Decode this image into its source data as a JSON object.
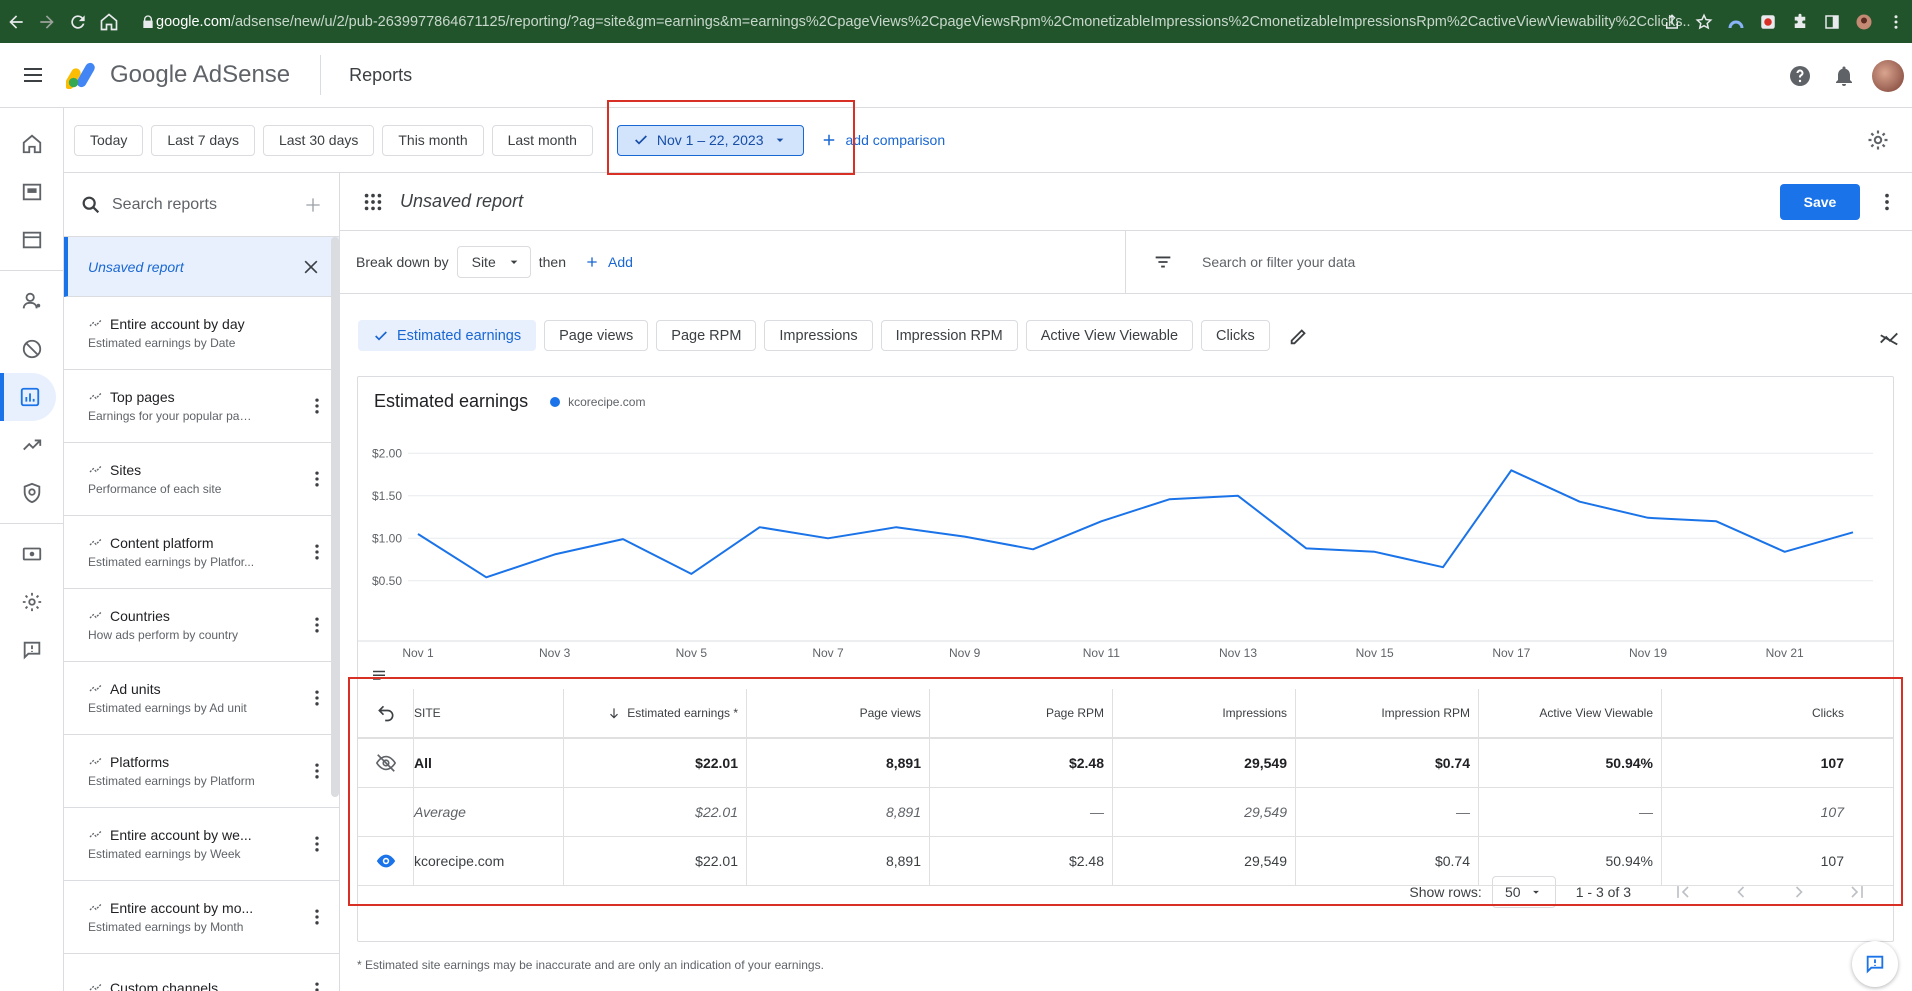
{
  "browser": {
    "url_host": "google.com",
    "url_path": "/adsense/new/u/2/pub-2639977864671125/reporting/?ag=site&gm=earnings&m=earnings%2CpageViews%2CpageViewsRpm%2CmonetizableImpressions%2CmonetizableImpressionsRpm%2CactiveViewViewability%2Cclicks..."
  },
  "header": {
    "product_google": "Google",
    "product_name": "AdSense",
    "title": "Reports"
  },
  "date_ranges": [
    "Today",
    "Last 7 days",
    "Last 30 days",
    "This month",
    "Last month"
  ],
  "selected_range": "Nov 1 – 22, 2023",
  "add_comparison": "add comparison",
  "sidebar": {
    "search_placeholder": "Search reports",
    "active_report": "Unsaved report",
    "reports": [
      {
        "title": "Entire account by day",
        "subtitle": "Estimated earnings by Date"
      },
      {
        "title": "Top pages",
        "subtitle": "Earnings for your popular pages"
      },
      {
        "title": "Sites",
        "subtitle": "Performance of each site"
      },
      {
        "title": "Content platform",
        "subtitle": "Estimated earnings by Platfor..."
      },
      {
        "title": "Countries",
        "subtitle": "How ads perform by country"
      },
      {
        "title": "Ad units",
        "subtitle": "Estimated earnings by Ad unit"
      },
      {
        "title": "Platforms",
        "subtitle": "Estimated earnings by Platform"
      },
      {
        "title": "Entire account by we...",
        "subtitle": "Estimated earnings by Week"
      },
      {
        "title": "Entire account by mo...",
        "subtitle": "Estimated earnings by Month"
      },
      {
        "title": "Custom channels",
        "subtitle": ""
      }
    ]
  },
  "report": {
    "title": "Unsaved report",
    "save_label": "Save",
    "breakdown_label": "Break down by",
    "breakdown_value": "Site",
    "then_label": "then",
    "add_label": "Add",
    "filter_placeholder": "Search or filter your data",
    "metrics": [
      "Estimated earnings",
      "Page views",
      "Page RPM",
      "Impressions",
      "Impression RPM",
      "Active View Viewable",
      "Clicks"
    ]
  },
  "chart_data": {
    "type": "line",
    "title": "Estimated earnings",
    "series": [
      {
        "name": "kcorecipe.com",
        "color": "#1a73e8",
        "values": [
          1.05,
          0.54,
          0.81,
          0.99,
          0.58,
          1.13,
          1.0,
          1.13,
          1.02,
          0.87,
          1.2,
          1.46,
          1.5,
          0.88,
          0.84,
          0.66,
          1.8,
          1.43,
          1.24,
          1.2,
          0.84,
          1.07
        ]
      }
    ],
    "x": [
      "Nov 1",
      "Nov 2",
      "Nov 3",
      "Nov 4",
      "Nov 5",
      "Nov 6",
      "Nov 7",
      "Nov 8",
      "Nov 9",
      "Nov 10",
      "Nov 11",
      "Nov 12",
      "Nov 13",
      "Nov 14",
      "Nov 15",
      "Nov 16",
      "Nov 17",
      "Nov 18",
      "Nov 19",
      "Nov 20",
      "Nov 21",
      "Nov 22"
    ],
    "x_tick_labels": [
      "Nov 1",
      "Nov 3",
      "Nov 5",
      "Nov 7",
      "Nov 9",
      "Nov 11",
      "Nov 13",
      "Nov 15",
      "Nov 17",
      "Nov 19",
      "Nov 21"
    ],
    "y_tick_labels": [
      "$2.00",
      "$1.50",
      "$1.00",
      "$0.50"
    ],
    "y_ticks": [
      2.0,
      1.5,
      1.0,
      0.5
    ],
    "ylim": [
      0.25,
      2.25
    ],
    "grid": true
  },
  "table": {
    "columns": [
      "SITE",
      "Estimated earnings *",
      "Page views",
      "Page RPM",
      "Impressions",
      "Impression RPM",
      "Active View Viewable",
      "Clicks"
    ],
    "rows": [
      {
        "site": "All",
        "cells": [
          "$22.01",
          "8,891",
          "$2.48",
          "29,549",
          "$0.74",
          "50.94%",
          "107"
        ]
      },
      {
        "site": "Average",
        "cells": [
          "$22.01",
          "8,891",
          "—",
          "29,549",
          "—",
          "—",
          "107"
        ]
      },
      {
        "site": "kcorecipe.com",
        "cells": [
          "$22.01",
          "8,891",
          "$2.48",
          "29,549",
          "$0.74",
          "50.94%",
          "107"
        ]
      }
    ]
  },
  "pager": {
    "show_rows_label": "Show rows:",
    "rows_value": "50",
    "range": "1 - 3 of 3"
  },
  "footnote": "* Estimated site earnings may be inaccurate and are only an indication of your earnings.",
  "colors": {
    "accent": "#1a73e8",
    "highlight_box": "#d93025",
    "browser_bar": "#22542c"
  }
}
